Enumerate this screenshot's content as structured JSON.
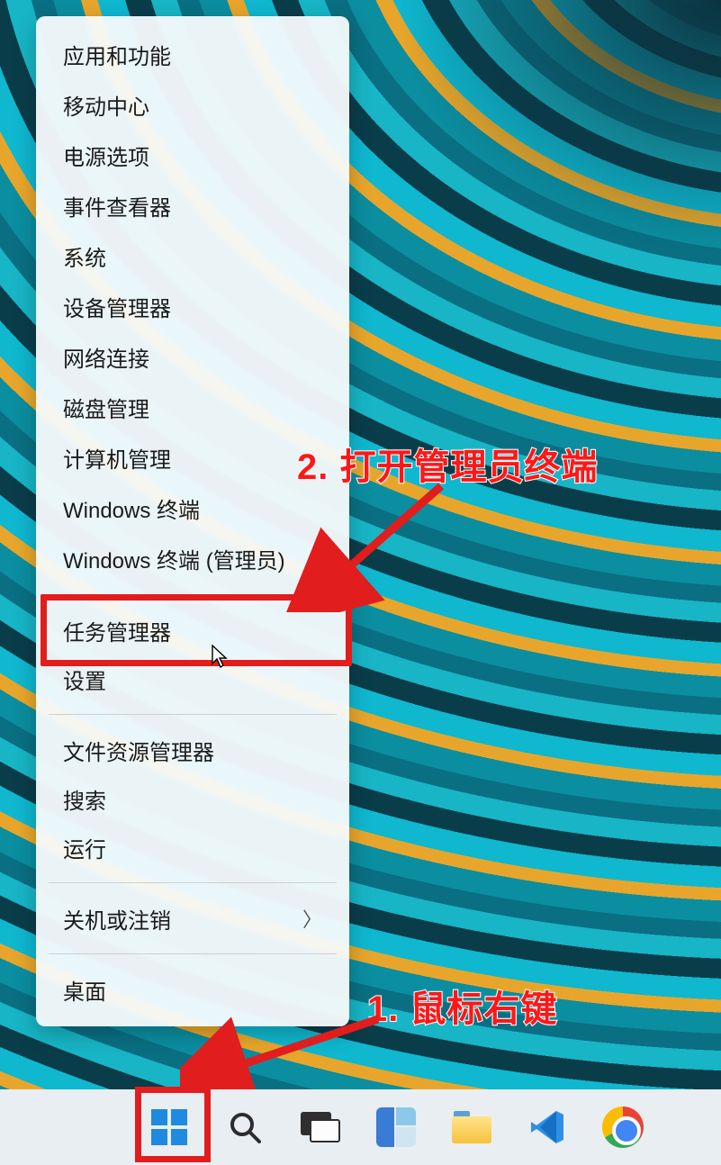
{
  "menu": {
    "groups": [
      {
        "items": [
          {
            "id": "apps-features",
            "label": "应用和功能"
          },
          {
            "id": "mobility-center",
            "label": "移动中心"
          },
          {
            "id": "power-options",
            "label": "电源选项"
          },
          {
            "id": "event-viewer",
            "label": "事件查看器"
          },
          {
            "id": "system",
            "label": "系统"
          },
          {
            "id": "device-manager",
            "label": "设备管理器"
          },
          {
            "id": "network-connections",
            "label": "网络连接"
          },
          {
            "id": "disk-management",
            "label": "磁盘管理"
          },
          {
            "id": "computer-management",
            "label": "计算机管理"
          },
          {
            "id": "windows-terminal",
            "label": "Windows 终端"
          },
          {
            "id": "windows-terminal-admin",
            "label": "Windows 终端 (管理员)"
          }
        ]
      },
      {
        "items": [
          {
            "id": "task-manager",
            "label": "任务管理器"
          },
          {
            "id": "settings",
            "label": "设置"
          }
        ]
      },
      {
        "items": [
          {
            "id": "file-explorer",
            "label": "文件资源管理器"
          },
          {
            "id": "search",
            "label": "搜索"
          },
          {
            "id": "run",
            "label": "运行"
          }
        ]
      },
      {
        "items": [
          {
            "id": "shutdown-signout",
            "label": "关机或注销",
            "submenu": true
          }
        ]
      },
      {
        "items": [
          {
            "id": "desktop",
            "label": "桌面"
          }
        ]
      }
    ]
  },
  "annotations": {
    "step1": "1. 鼠标右键",
    "step2": "2. 打开管理员终端"
  },
  "taskbar": {
    "icons": [
      {
        "id": "start",
        "name": "start-icon"
      },
      {
        "id": "search",
        "name": "search-icon"
      },
      {
        "id": "task-view",
        "name": "task-view-icon"
      },
      {
        "id": "widgets",
        "name": "widgets-icon"
      },
      {
        "id": "file-explorer",
        "name": "file-explorer-icon"
      },
      {
        "id": "vscode",
        "name": "vscode-icon"
      },
      {
        "id": "chrome",
        "name": "chrome-icon"
      }
    ]
  },
  "colors": {
    "highlight": "#e21d1d",
    "annotation_text": "#ff1717"
  }
}
